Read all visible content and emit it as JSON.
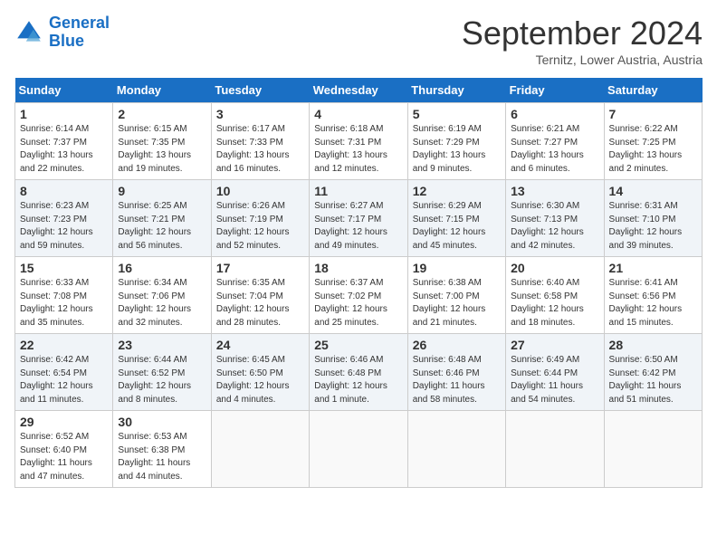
{
  "header": {
    "logo_line1": "General",
    "logo_line2": "Blue",
    "month_title": "September 2024",
    "location": "Ternitz, Lower Austria, Austria"
  },
  "calendar": {
    "days_of_week": [
      "Sunday",
      "Monday",
      "Tuesday",
      "Wednesday",
      "Thursday",
      "Friday",
      "Saturday"
    ],
    "weeks": [
      [
        null,
        {
          "day": "2",
          "info": "Sunrise: 6:15 AM\nSunset: 7:35 PM\nDaylight: 13 hours\nand 19 minutes."
        },
        {
          "day": "3",
          "info": "Sunrise: 6:17 AM\nSunset: 7:33 PM\nDaylight: 13 hours\nand 16 minutes."
        },
        {
          "day": "4",
          "info": "Sunrise: 6:18 AM\nSunset: 7:31 PM\nDaylight: 13 hours\nand 12 minutes."
        },
        {
          "day": "5",
          "info": "Sunrise: 6:19 AM\nSunset: 7:29 PM\nDaylight: 13 hours\nand 9 minutes."
        },
        {
          "day": "6",
          "info": "Sunrise: 6:21 AM\nSunset: 7:27 PM\nDaylight: 13 hours\nand 6 minutes."
        },
        {
          "day": "7",
          "info": "Sunrise: 6:22 AM\nSunset: 7:25 PM\nDaylight: 13 hours\nand 2 minutes."
        }
      ],
      [
        {
          "day": "1",
          "info": "Sunrise: 6:14 AM\nSunset: 7:37 PM\nDaylight: 13 hours\nand 22 minutes."
        },
        null,
        null,
        null,
        null,
        null,
        null
      ],
      [
        {
          "day": "8",
          "info": "Sunrise: 6:23 AM\nSunset: 7:23 PM\nDaylight: 12 hours\nand 59 minutes."
        },
        {
          "day": "9",
          "info": "Sunrise: 6:25 AM\nSunset: 7:21 PM\nDaylight: 12 hours\nand 56 minutes."
        },
        {
          "day": "10",
          "info": "Sunrise: 6:26 AM\nSunset: 7:19 PM\nDaylight: 12 hours\nand 52 minutes."
        },
        {
          "day": "11",
          "info": "Sunrise: 6:27 AM\nSunset: 7:17 PM\nDaylight: 12 hours\nand 49 minutes."
        },
        {
          "day": "12",
          "info": "Sunrise: 6:29 AM\nSunset: 7:15 PM\nDaylight: 12 hours\nand 45 minutes."
        },
        {
          "day": "13",
          "info": "Sunrise: 6:30 AM\nSunset: 7:13 PM\nDaylight: 12 hours\nand 42 minutes."
        },
        {
          "day": "14",
          "info": "Sunrise: 6:31 AM\nSunset: 7:10 PM\nDaylight: 12 hours\nand 39 minutes."
        }
      ],
      [
        {
          "day": "15",
          "info": "Sunrise: 6:33 AM\nSunset: 7:08 PM\nDaylight: 12 hours\nand 35 minutes."
        },
        {
          "day": "16",
          "info": "Sunrise: 6:34 AM\nSunset: 7:06 PM\nDaylight: 12 hours\nand 32 minutes."
        },
        {
          "day": "17",
          "info": "Sunrise: 6:35 AM\nSunset: 7:04 PM\nDaylight: 12 hours\nand 28 minutes."
        },
        {
          "day": "18",
          "info": "Sunrise: 6:37 AM\nSunset: 7:02 PM\nDaylight: 12 hours\nand 25 minutes."
        },
        {
          "day": "19",
          "info": "Sunrise: 6:38 AM\nSunset: 7:00 PM\nDaylight: 12 hours\nand 21 minutes."
        },
        {
          "day": "20",
          "info": "Sunrise: 6:40 AM\nSunset: 6:58 PM\nDaylight: 12 hours\nand 18 minutes."
        },
        {
          "day": "21",
          "info": "Sunrise: 6:41 AM\nSunset: 6:56 PM\nDaylight: 12 hours\nand 15 minutes."
        }
      ],
      [
        {
          "day": "22",
          "info": "Sunrise: 6:42 AM\nSunset: 6:54 PM\nDaylight: 12 hours\nand 11 minutes."
        },
        {
          "day": "23",
          "info": "Sunrise: 6:44 AM\nSunset: 6:52 PM\nDaylight: 12 hours\nand 8 minutes."
        },
        {
          "day": "24",
          "info": "Sunrise: 6:45 AM\nSunset: 6:50 PM\nDaylight: 12 hours\nand 4 minutes."
        },
        {
          "day": "25",
          "info": "Sunrise: 6:46 AM\nSunset: 6:48 PM\nDaylight: 12 hours\nand 1 minute."
        },
        {
          "day": "26",
          "info": "Sunrise: 6:48 AM\nSunset: 6:46 PM\nDaylight: 11 hours\nand 58 minutes."
        },
        {
          "day": "27",
          "info": "Sunrise: 6:49 AM\nSunset: 6:44 PM\nDaylight: 11 hours\nand 54 minutes."
        },
        {
          "day": "28",
          "info": "Sunrise: 6:50 AM\nSunset: 6:42 PM\nDaylight: 11 hours\nand 51 minutes."
        }
      ],
      [
        {
          "day": "29",
          "info": "Sunrise: 6:52 AM\nSunset: 6:40 PM\nDaylight: 11 hours\nand 47 minutes."
        },
        {
          "day": "30",
          "info": "Sunrise: 6:53 AM\nSunset: 6:38 PM\nDaylight: 11 hours\nand 44 minutes."
        },
        null,
        null,
        null,
        null,
        null
      ]
    ]
  }
}
